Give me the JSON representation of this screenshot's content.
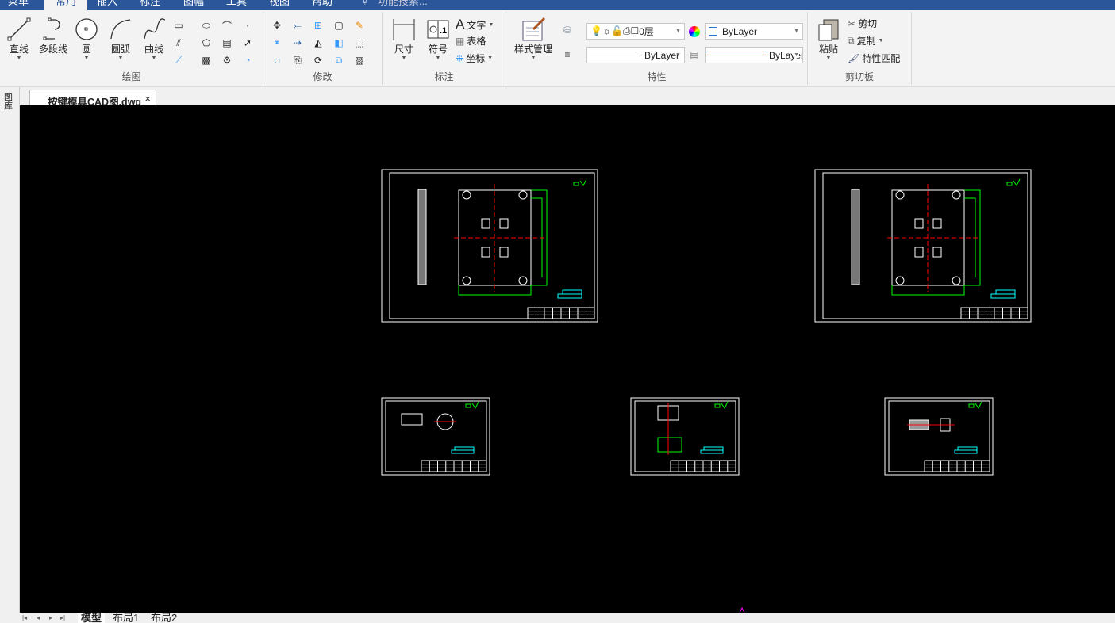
{
  "menu_tabs": [
    "菜单",
    "常用",
    "插入",
    "标注",
    "图幅",
    "工具",
    "视图",
    "帮助"
  ],
  "active_tab": "常用",
  "search_placeholder": "功能搜索...",
  "ribbon": {
    "draw": {
      "label": "绘图",
      "tools": [
        "直线",
        "多段线",
        "圆",
        "圆弧",
        "曲线"
      ]
    },
    "modify": {
      "label": "修改"
    },
    "annotate": {
      "label": "标注",
      "tools": [
        "尺寸",
        "符号"
      ],
      "small": [
        "文字",
        "表格",
        "坐标"
      ]
    },
    "properties": {
      "label": "特性",
      "style_manager": "样式管理",
      "layer": "0层",
      "color": "ByLayer",
      "linetype": "ByLayer",
      "lineweight": "ByLayer"
    },
    "clipboard": {
      "label": "剪切板",
      "paste": "粘贴",
      "cut": "剪切",
      "copy": "复制",
      "match": "特性匹配"
    }
  },
  "document_tab": {
    "title": "按键模具CAD图.dwg",
    "close": "×"
  },
  "left_panel": {
    "label": "图库"
  },
  "layout_tabs": [
    "模型",
    "布局1",
    "布局2"
  ],
  "nav_buttons": [
    "|◂",
    "◂",
    "▸",
    "▸|"
  ],
  "colors": {
    "accent": "#2b579a",
    "canvas": "#000000",
    "green": "#00ff00",
    "red": "#ff0000",
    "magenta": "#ff00ff",
    "cyan": "#00ffff"
  }
}
